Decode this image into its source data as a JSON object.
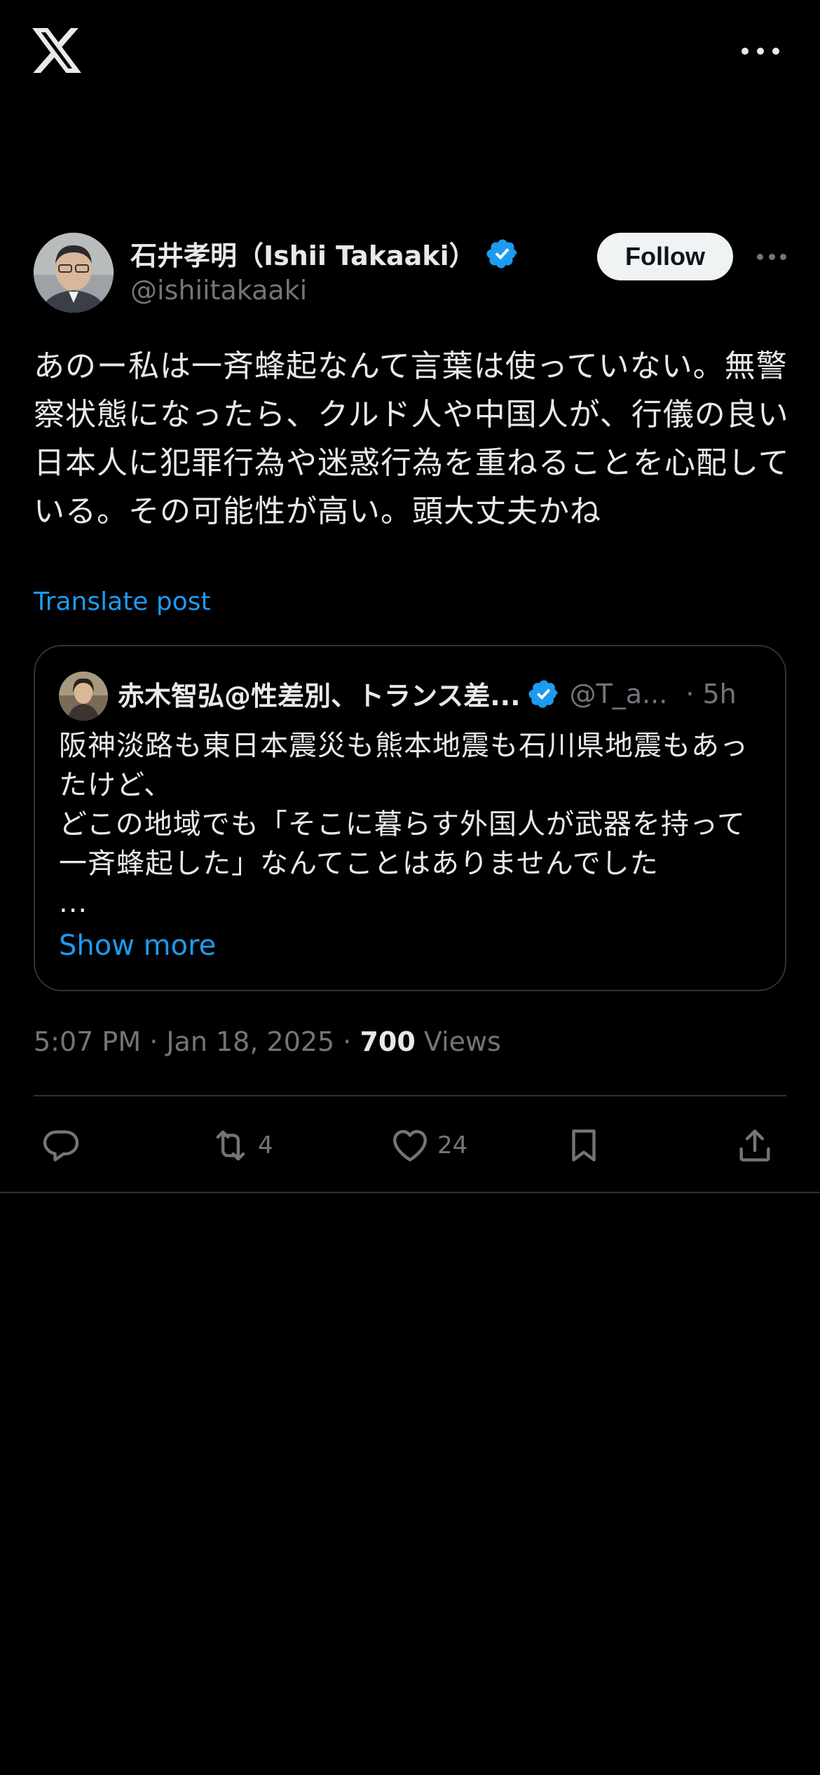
{
  "author": {
    "name": "石井孝明（Ishii Takaaki）",
    "handle": "@ishiitakaaki",
    "follow_label": "Follow"
  },
  "post": {
    "text": "あのー私は一斉蜂起なんて言葉は使っていない。無警察状態になったら、クルド人や中国人が、行儀の良い日本人に犯罪行為や迷惑行為を重ねることを心配している。その可能性が高い。頭大丈夫かね",
    "translate_label": "Translate post",
    "time": "5:07 PM · Jan 18, 2025 · ",
    "views_count": "700",
    "views_label": " Views"
  },
  "quote": {
    "name": "赤木智弘@性差別、トランス差...",
    "handle": "@T_a...",
    "time": "· 5h",
    "text": "阪神淡路も東日本震災も熊本地震も石川県地震もあったけど、\nどこの地域でも「そこに暮らす外国人が武器を持って一斉蜂起した」なんてことはありませんでした\n...",
    "show_more_label": "Show more"
  },
  "actions": {
    "reply_icon": "reply-icon",
    "retweet_count": "4",
    "like_count": "24",
    "bookmark_icon": "bookmark-icon",
    "share_icon": "share-icon"
  },
  "colors": {
    "background": "#000000",
    "accent": "#1d9bf0",
    "secondary_text": "#71767b",
    "border": "#2f3336"
  }
}
